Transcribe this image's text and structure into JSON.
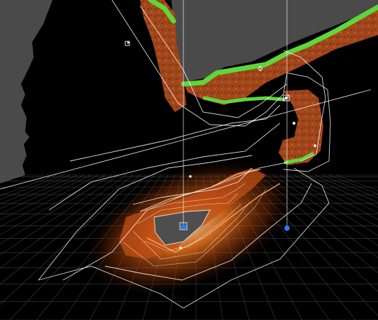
{
  "editor": {
    "view_mode": "scene-perspective",
    "background_color": "#4a4a4a",
    "silhouette_color": "#000000",
    "grid_color": "#5a5a5a",
    "wireframe_color": "#ffffff"
  },
  "scene": {
    "terrain": {
      "grass_color": "#5fd63a",
      "dirt_color": "#a2461b",
      "dirt_dark_color": "#5e2410"
    },
    "light": {
      "glow_color": "#ff7a1c",
      "core_color": "#4a4a4a"
    },
    "handles": [
      {
        "name": "pivot-handle-1",
        "color": "#2c7cff"
      },
      {
        "name": "pivot-handle-2",
        "color": "#2c7cff"
      }
    ],
    "gizmo_icons": [
      "camera-gizmo-icon",
      "light-gizmo-icon",
      "selection-gizmo-icon"
    ]
  }
}
